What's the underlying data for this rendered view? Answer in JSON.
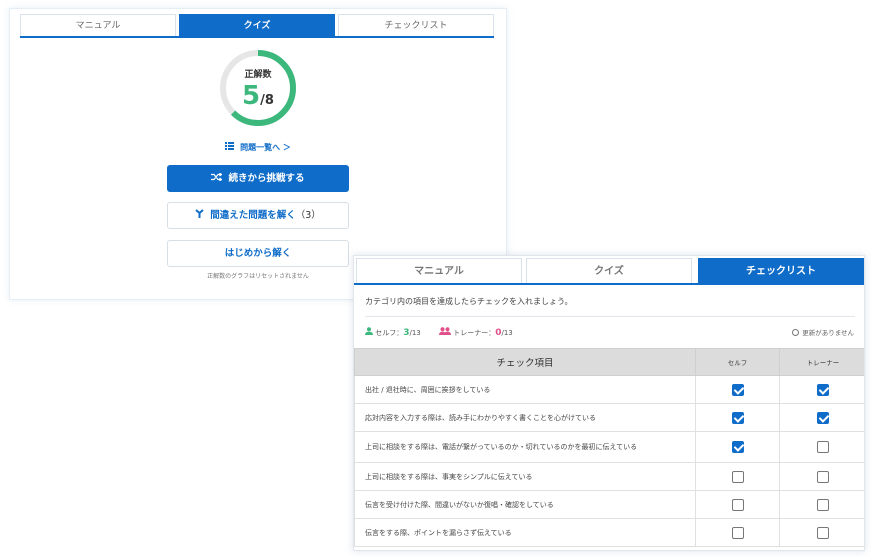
{
  "quiz_panel": {
    "tabs": [
      "マニュアル",
      "クイズ",
      "チェックリスト"
    ],
    "active_tab": 1,
    "score_label": "正解数",
    "score_correct": "5",
    "score_total": "/8",
    "score_fraction": 0.625,
    "question_list_link": "問題一覧へ ＞",
    "continue_button": "続きから挑戦する",
    "retry_wrong_button": "間違えた問題を解く",
    "retry_wrong_count": "（3）",
    "restart_button": "はじめから解く",
    "note": "正解数のグラフはリセットされません"
  },
  "checklist_panel": {
    "tabs": [
      "マニュアル",
      "クイズ",
      "チェックリスト"
    ],
    "active_tab": 2,
    "instruction": "カテゴリ内の項目を達成したらチェックを入れましょう。",
    "self_label": "セルフ：",
    "self_count": "3",
    "self_total": "/13",
    "trainer_label": "トレーナー：",
    "trainer_count": "0",
    "trainer_total": "/13",
    "no_update_text": "更新がありません",
    "columns": [
      "チェック項目",
      "セルフ",
      "トレーナー"
    ],
    "rows": [
      {
        "item": "出社 / 退社時に、周囲に挨拶をしている",
        "self": true,
        "trainer": true
      },
      {
        "item": "応対内容を入力する際は、読み手にわかりやすく書くことを心がけている",
        "self": true,
        "trainer": true
      },
      {
        "item": "上司に相談をする際は、電話が繋がっているのか・切れているのかを最初に伝えている",
        "self": true,
        "trainer": false
      },
      {
        "item": "上司に相談をする際は、事実をシンプルに伝えている",
        "self": false,
        "trainer": false
      },
      {
        "item": "伝言を受け付けた際、間違いがないか復唱・確認をしている",
        "self": false,
        "trainer": false
      },
      {
        "item": "伝言をする際、ポイントを漏らさず伝えている",
        "self": false,
        "trainer": false
      }
    ]
  },
  "colors": {
    "primary": "#0f6cc8",
    "accent_green": "#3db87d",
    "accent_pink": "#e0508a",
    "ring_track": "#e6e6e6"
  },
  "icons": {
    "list": "list-icon",
    "shuffle": "shuffle-icon",
    "branch": "branch-icon",
    "self_user": "user-icon",
    "trainer_users": "users-icon",
    "no_update": "circle-icon"
  }
}
